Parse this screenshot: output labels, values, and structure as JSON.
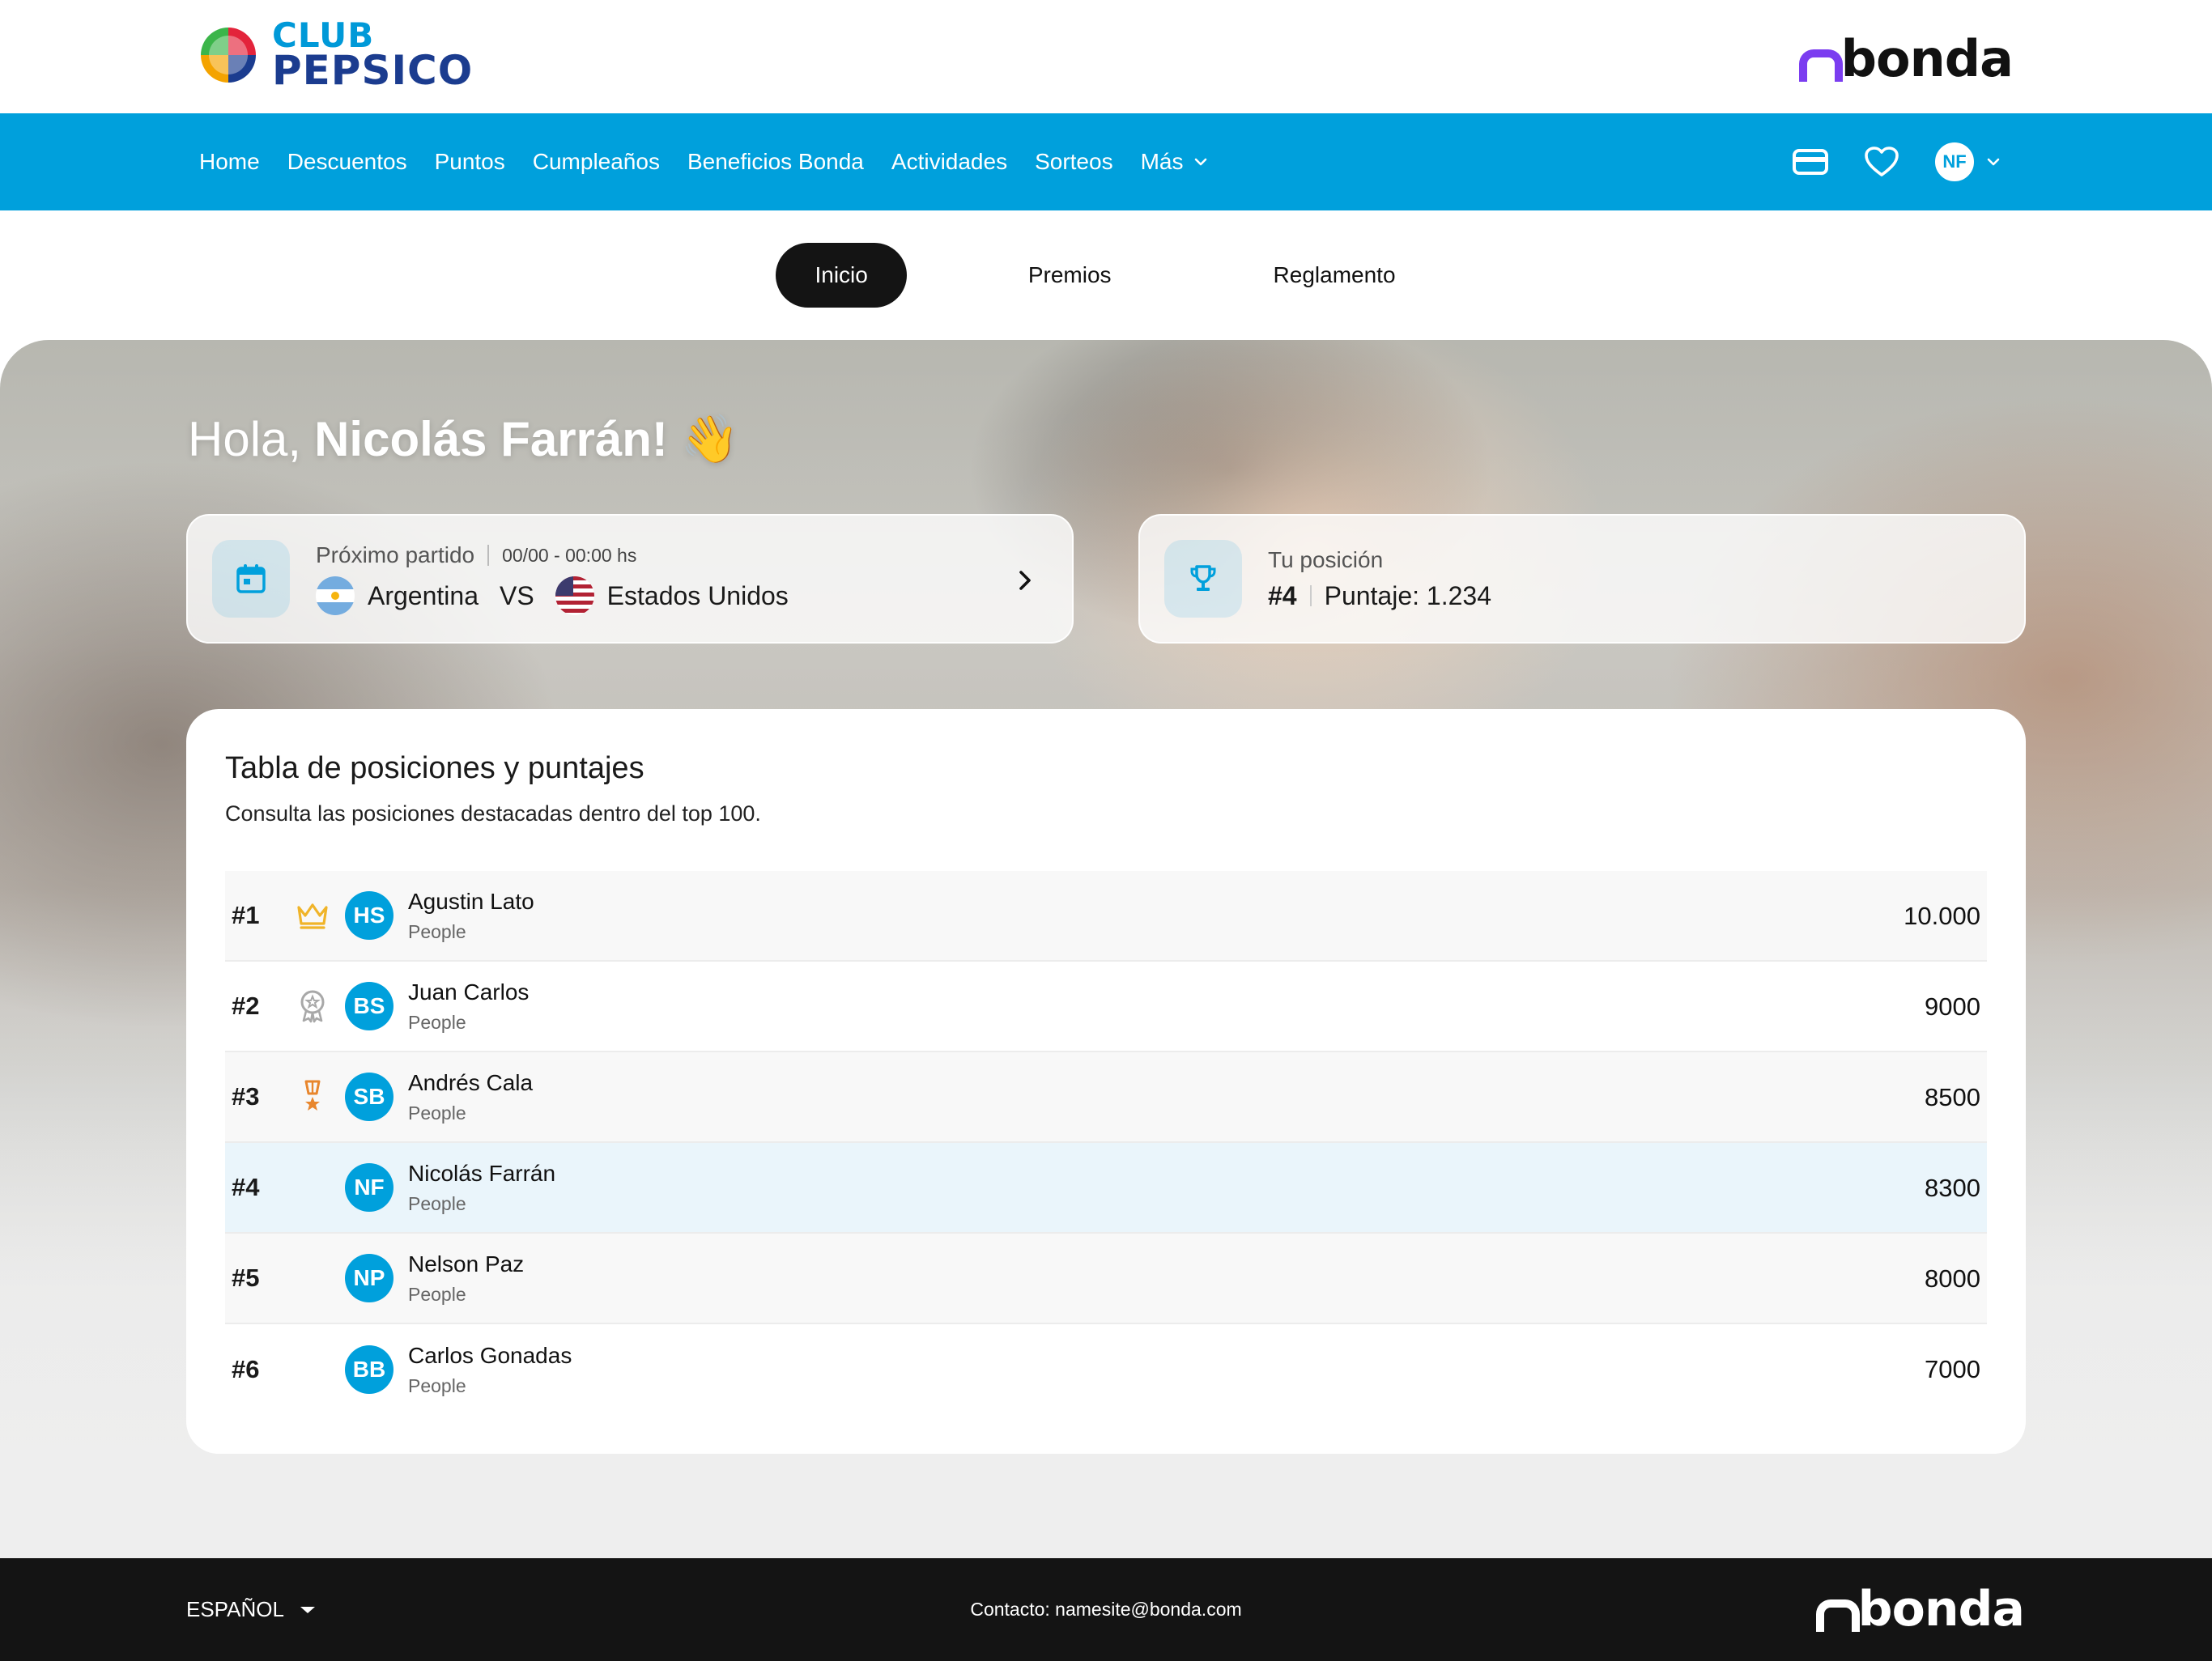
{
  "header": {
    "club_line1": "CLUB",
    "club_line2": "PEPSICO",
    "brand": "bonda"
  },
  "nav": {
    "items": [
      {
        "label": "Home"
      },
      {
        "label": "Descuentos"
      },
      {
        "label": "Puntos"
      },
      {
        "label": "Cumpleaños"
      },
      {
        "label": "Beneficios Bonda"
      },
      {
        "label": "Actividades"
      },
      {
        "label": "Sorteos"
      },
      {
        "label": "Más"
      }
    ],
    "user_initials": "NF",
    "icons": [
      "wallet-icon",
      "heart-icon",
      "chevron-down-icon"
    ]
  },
  "tabs": [
    {
      "label": "Inicio",
      "active": true
    },
    {
      "label": "Premios",
      "active": false
    },
    {
      "label": "Reglamento",
      "active": false
    }
  ],
  "hero": {
    "greeting_prefix": "Hola,",
    "greeting_name": "Nicolás Farrán!",
    "wave_emoji": "👋"
  },
  "next_match": {
    "label": "Próximo partido",
    "datetime": "00/00 - 00:00 hs",
    "team_a": "Argentina",
    "vs": "VS",
    "team_b": "Estados Unidos"
  },
  "position_card": {
    "label": "Tu posición",
    "position": "#4",
    "score_text": "Puntaje: 1.234"
  },
  "leaderboard": {
    "title": "Tabla de posiciones y puntajes",
    "subtitle": "Consulta las posiciones destacadas dentro del top 100.",
    "rows": [
      {
        "rank": "#1",
        "medal": "crown-icon",
        "initials": "HS",
        "name": "Agustin Lato",
        "org": "People",
        "score": "10.000"
      },
      {
        "rank": "#2",
        "medal": "silver-medal-icon",
        "initials": "BS",
        "name": "Juan Carlos",
        "org": "People",
        "score": "9000"
      },
      {
        "rank": "#3",
        "medal": "bronze-medal-icon",
        "initials": "SB",
        "name": "Andrés Cala",
        "org": "People",
        "score": "8500"
      },
      {
        "rank": "#4",
        "medal": "",
        "initials": "NF",
        "name": "Nicolás Farrán",
        "org": "People",
        "score": "8300"
      },
      {
        "rank": "#5",
        "medal": "",
        "initials": "NP",
        "name": "Nelson Paz",
        "org": "People",
        "score": "8000"
      },
      {
        "rank": "#6",
        "medal": "",
        "initials": "BB",
        "name": "Carlos Gonadas",
        "org": "People",
        "score": "7000"
      }
    ]
  },
  "footer": {
    "language": "ESPAÑOL",
    "contact": "Contacto: namesite@bonda.com",
    "brand": "bonda"
  },
  "colors": {
    "primary": "#00a0dc",
    "dark": "#141414",
    "bonda_accent": "#7b3df0",
    "gold": "#f0b429",
    "silver": "#a8a8a8",
    "bronze": "#e8862d"
  }
}
